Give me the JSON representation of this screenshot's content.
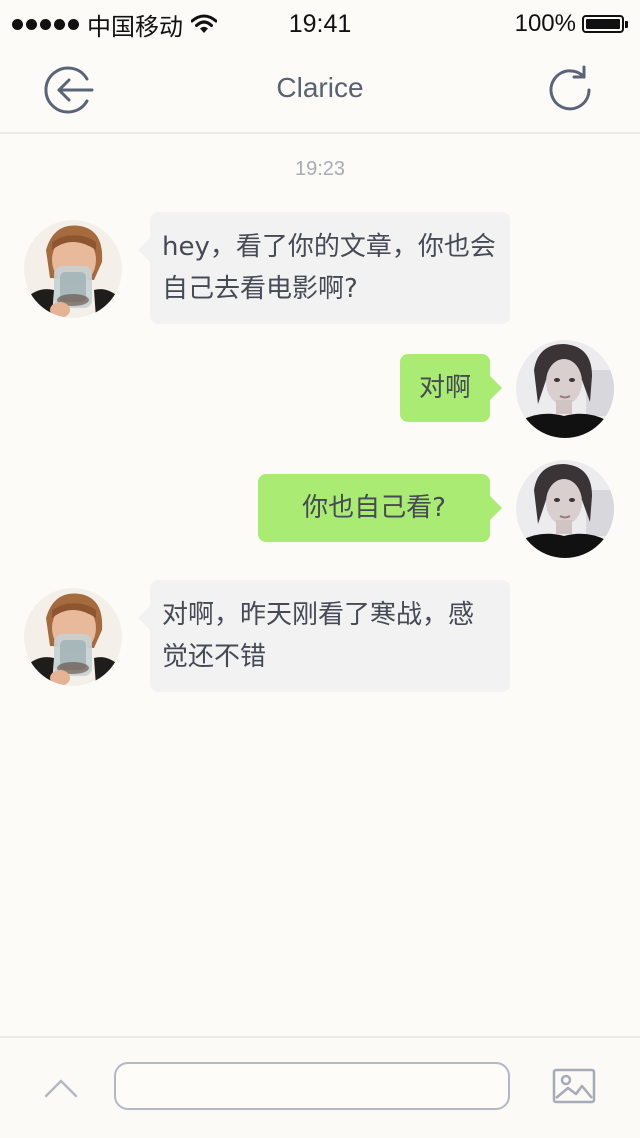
{
  "status_bar": {
    "carrier": "中国移动",
    "time": "19:41",
    "battery": "100%"
  },
  "nav": {
    "title": "Clarice",
    "back_icon": "back-arrow-icon",
    "refresh_icon": "refresh-icon"
  },
  "chat": {
    "timestamp": "19:23",
    "messages": [
      {
        "direction": "incoming",
        "text": "hey，看了你的文章，你也会自己去看电影啊?"
      },
      {
        "direction": "outgoing",
        "text": "对啊"
      },
      {
        "direction": "outgoing",
        "text": "你也自己看?"
      },
      {
        "direction": "incoming",
        "text": "对啊，昨天刚看了寒战，感觉还不错"
      }
    ]
  },
  "composer": {
    "input_value": "",
    "input_placeholder": "",
    "expand_icon": "chevron-up-icon",
    "image_icon": "image-icon"
  },
  "colors": {
    "background": "#fcfbf7",
    "incoming_bubble": "#f2f2f3",
    "outgoing_bubble": "#a9eb73",
    "icon_stroke": "#5a6478"
  }
}
